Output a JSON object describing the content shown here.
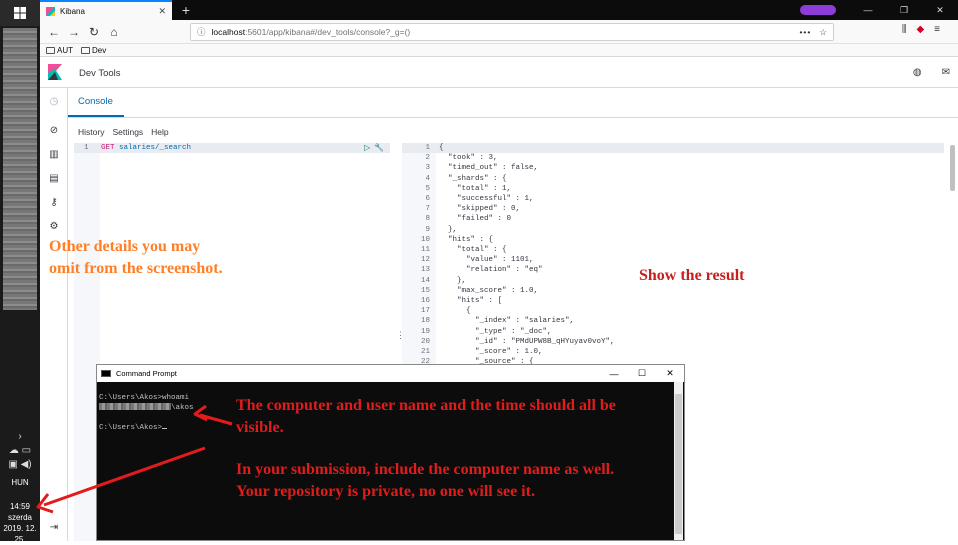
{
  "browser": {
    "tab_title": "Kibana",
    "url_host": "localhost",
    "url_path": ":5601/app/kibana#/dev_tools/console?_g=()",
    "bookmarks": [
      "AUT",
      "Dev"
    ]
  },
  "kibana": {
    "app_title": "Dev Tools",
    "tab": "Console",
    "menu": [
      "History",
      "Settings",
      "Help"
    ],
    "request": {
      "line_number": "1",
      "method": "GET",
      "path": "salaries/_search"
    },
    "response_lines": [
      {
        "n": "1",
        "text": "{"
      },
      {
        "n": "2",
        "text": "  \"took\" : 3,"
      },
      {
        "n": "3",
        "text": "  \"timed_out\" : false,"
      },
      {
        "n": "4",
        "text": "  \"_shards\" : {"
      },
      {
        "n": "5",
        "text": "    \"total\" : 1,"
      },
      {
        "n": "6",
        "text": "    \"successful\" : 1,"
      },
      {
        "n": "7",
        "text": "    \"skipped\" : 0,"
      },
      {
        "n": "8",
        "text": "    \"failed\" : 0"
      },
      {
        "n": "9",
        "text": "  },"
      },
      {
        "n": "10",
        "text": "  \"hits\" : {"
      },
      {
        "n": "11",
        "text": "    \"total\" : {"
      },
      {
        "n": "12",
        "text": "      \"value\" : 1101,"
      },
      {
        "n": "13",
        "text": "      \"relation\" : \"eq\""
      },
      {
        "n": "14",
        "text": "    },"
      },
      {
        "n": "15",
        "text": "    \"max_score\" : 1.0,"
      },
      {
        "n": "16",
        "text": "    \"hits\" : ["
      },
      {
        "n": "17",
        "text": "      {"
      },
      {
        "n": "18",
        "text": "        \"_index\" : \"salaries\","
      },
      {
        "n": "19",
        "text": "        \"_type\" : \"_doc\","
      },
      {
        "n": "20",
        "text": "        \"_id\" : \"PMdUPW8B_qHYuyav0voY\","
      },
      {
        "n": "21",
        "text": "        \"_score\" : 1.0,"
      },
      {
        "n": "22",
        "text": "        \"_source\" : {"
      }
    ]
  },
  "cmd": {
    "title": "Command Prompt",
    "line1": "C:\\Users\\Akos>whoami",
    "line2_suffix": "\\akos",
    "line3": "C:\\Users\\Akos>"
  },
  "taskbar": {
    "lang": "HUN",
    "time": "14:59",
    "day": "szerda",
    "date": "2019. 12. 25."
  },
  "annotations": {
    "left_note": "Other details you may omit from the screenshot.",
    "result_note": "Show the result",
    "cmd_note1": "The computer and user name and the time should all be visible.",
    "cmd_note2": "In your submission, include the computer name as well. Your repository is private, no one will see it."
  }
}
